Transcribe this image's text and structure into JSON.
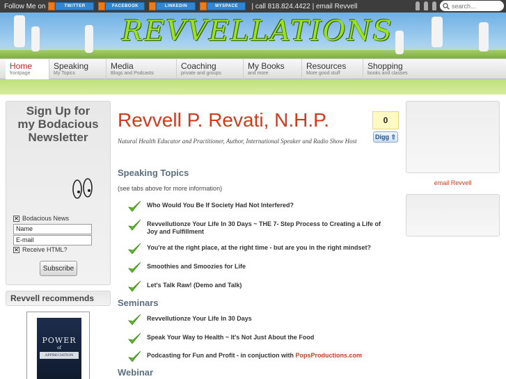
{
  "topbar": {
    "follow_label": "Follow Me on",
    "social": [
      "TWITTER",
      "FACEBOOK",
      "LINKEDIN",
      "MYSPACE"
    ],
    "contact": "| call 818.824.4422 | email Revvell",
    "search_placeholder": "search..."
  },
  "banner": {
    "logo_text": "REVVELLATIONS"
  },
  "nav": [
    {
      "title": "Home",
      "sub": "frontpage"
    },
    {
      "title": "Speaking",
      "sub": "My Topics"
    },
    {
      "title": "Media",
      "sub": "Blogs and Podcasts"
    },
    {
      "title": "Coaching",
      "sub": "private and groups"
    },
    {
      "title": "My Books",
      "sub": "and more"
    },
    {
      "title": "Resources",
      "sub": "More good stuff"
    },
    {
      "title": "Shopping",
      "sub": "books and classes"
    }
  ],
  "signup": {
    "title": "Sign Up for my Bodacious Newsletter",
    "list_option": "Bodacious News",
    "name_field": "Name",
    "email_field": "E-mail",
    "html_option": "Receive HTML?",
    "subscribe_label": "Subscribe"
  },
  "recommends": {
    "title": "Revvell recommends",
    "book_title_1": "POWER",
    "book_title_2": "of",
    "book_title_3": "APPRECIATION"
  },
  "main": {
    "title": "Revvell P. Revati, N.H.P.",
    "tagline": "Natural Health Educator and Practitioner, Author, International Speaker and Radio Show Host",
    "digg_count": "0",
    "digg_label": "Digg",
    "speaking_heading": "Speaking Topics",
    "speaking_note": "(see tabs above for more information)",
    "speaking_items": [
      "Who Would You Be If Society Had Not Interfered?",
      "Revvellutionze Your Life In 30 Days ~ THE 7- Step Process to Creating a Life of Joy and Fulfillment",
      "You're at the right place, at the right time - but are you in the right mindset?",
      "Smoothies and Smoozies for Life",
      "Let's Talk Raw! (Demo and Talk)"
    ],
    "seminars_heading": "Seminars",
    "seminar_items": [
      "Revvellutionze Your Life In 30 Days",
      "Speak Your Way to Health ~ It's Not Just About the Food"
    ],
    "seminar_last_prefix": "Podcasting for Fun and Profit - in conjuction with ",
    "seminar_last_link": "PopsProductions.com",
    "webinar_heading": "Webinar"
  },
  "right": {
    "email_link": "email Revvell"
  },
  "colors": {
    "accent_red": "#d43a1a",
    "topbar": "#3d3d3d",
    "logo_green": "#9be21f"
  }
}
